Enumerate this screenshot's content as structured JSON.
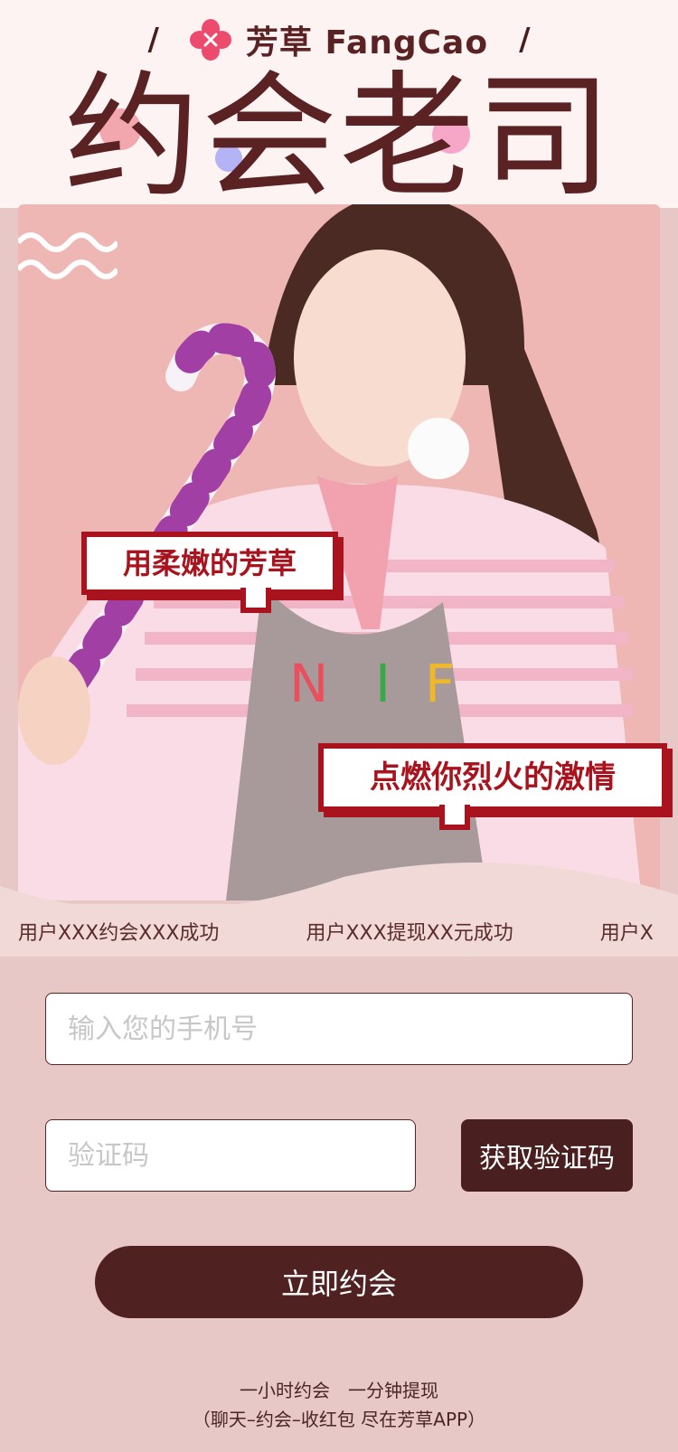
{
  "brand": {
    "name": "芳草 FangCao",
    "slash": "/"
  },
  "hero": {
    "title": "约会老司机",
    "bubble1": "用柔嫩的芳草",
    "bubble2": "点燃你烈火的激情"
  },
  "ticker": {
    "items": [
      "用户XXX约会XXX成功",
      "用户XXX提现XX元成功",
      "用户X"
    ]
  },
  "form": {
    "phone_placeholder": "输入您的手机号",
    "code_placeholder": "验证码",
    "get_code_label": "获取验证码",
    "submit_label": "立即约会"
  },
  "footer": {
    "line1": "一小时约会　一分钟提现",
    "line2": "（聊天–约会–收红包  尽在芳草APP）"
  },
  "colors": {
    "primary": "#4f2121",
    "accent_red": "#a8131e",
    "logo_pink": "#ec4b6e",
    "background": "#e8c8c7"
  },
  "icons": {
    "logo": "four-petal-flower-logo"
  }
}
